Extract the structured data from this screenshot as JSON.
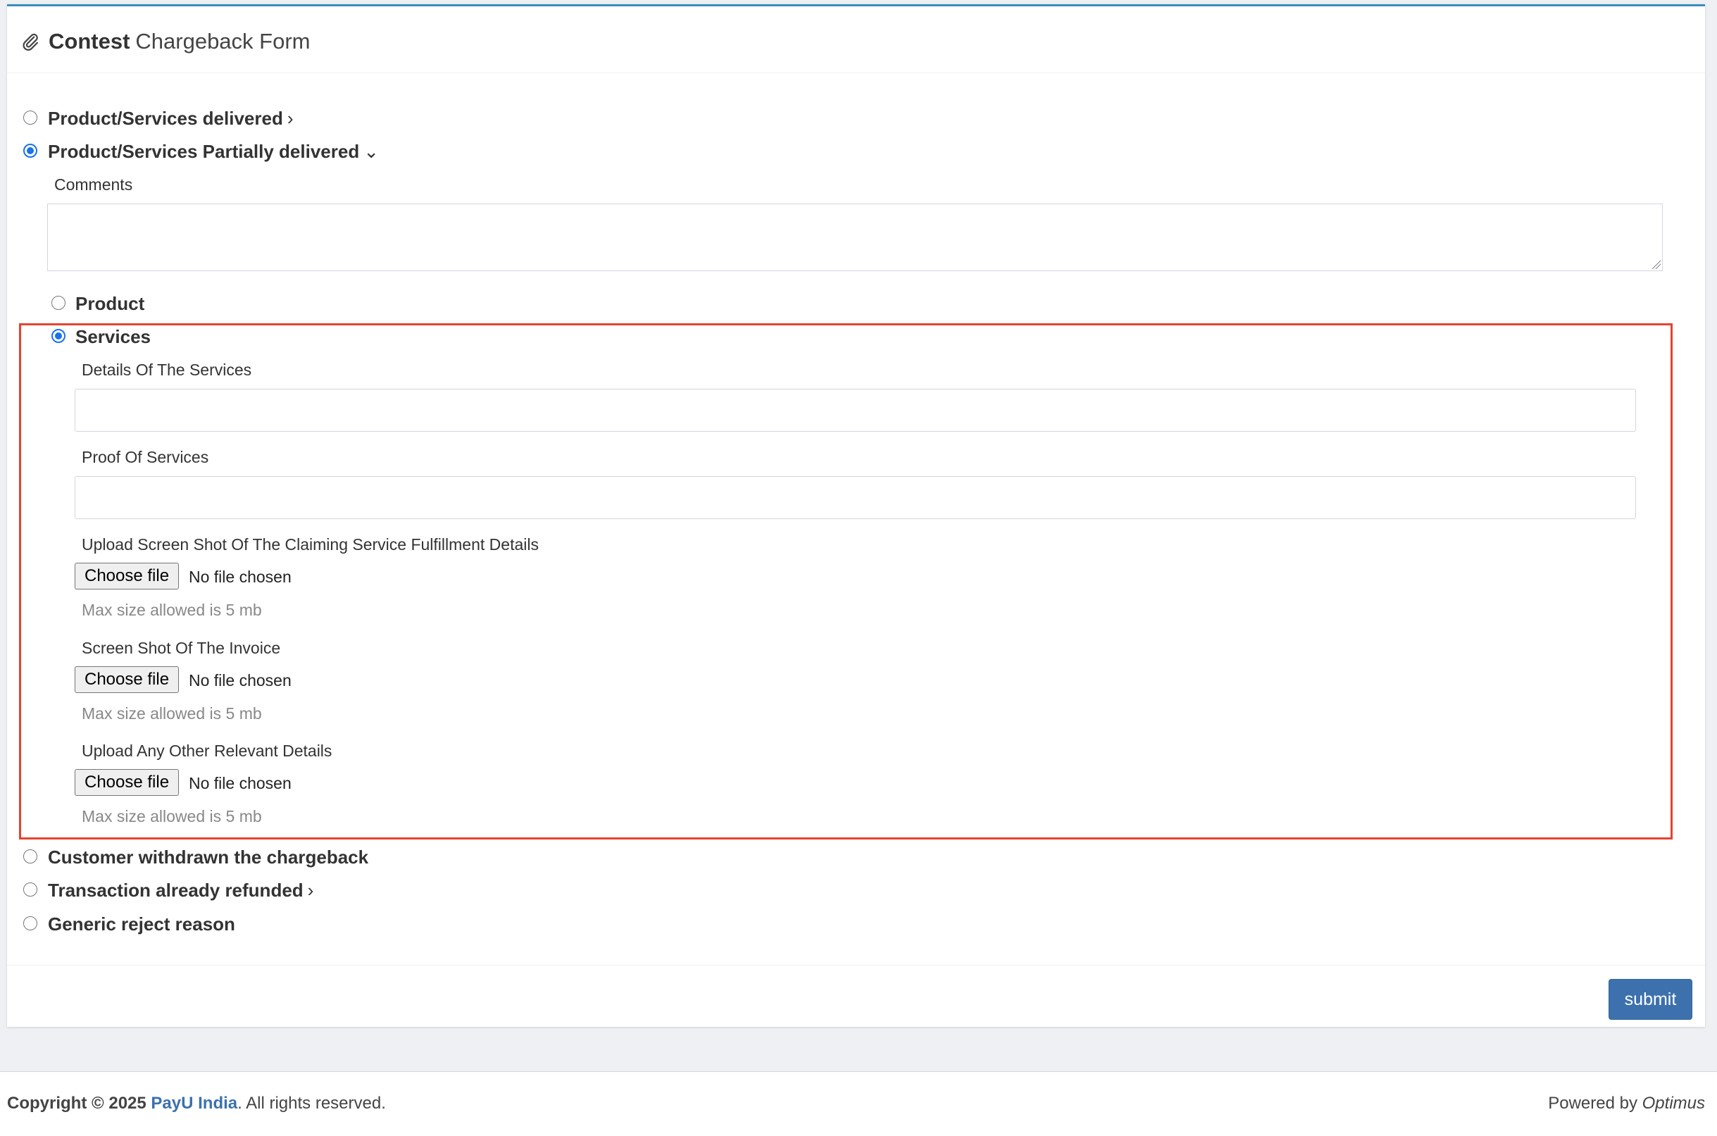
{
  "header": {
    "title_bold": "Contest",
    "title_rest": "Chargeback Form",
    "icon": "paperclip-icon"
  },
  "options": [
    {
      "label": "Product/Services delivered",
      "selected": false,
      "chevron": "›"
    },
    {
      "label": "Product/Services Partially delivered",
      "selected": true,
      "chevron": "⌄"
    },
    {
      "label": "Customer withdrawn the chargeback",
      "selected": false
    },
    {
      "label": "Transaction already refunded",
      "selected": false,
      "chevron": "›"
    },
    {
      "label": "Generic reject reason",
      "selected": false
    }
  ],
  "partial": {
    "comments_label": "Comments",
    "comments_value": "",
    "sub_options": [
      {
        "label": "Product",
        "selected": false
      },
      {
        "label": "Services",
        "selected": true
      }
    ]
  },
  "services": {
    "details_label": "Details Of The Services",
    "details_value": "",
    "proof_label": "Proof Of Services",
    "proof_value": "",
    "uploads": [
      {
        "label": "Upload Screen Shot Of The Claiming Service Fulfillment Details",
        "button": "Choose file",
        "status": "No file chosen",
        "help": "Max size allowed is 5 mb"
      },
      {
        "label": "Screen Shot Of The Invoice",
        "button": "Choose file",
        "status": "No file chosen",
        "help": "Max size allowed is 5 mb"
      },
      {
        "label": "Upload Any Other Relevant Details",
        "button": "Choose file",
        "status": "No file chosen",
        "help": "Max size allowed is 5 mb"
      }
    ]
  },
  "actions": {
    "submit_label": "submit"
  },
  "footer": {
    "copyright_prefix": "Copyright © 2025",
    "brand": "PayU India",
    "copyright_suffix": ". All rights reserved.",
    "powered_prefix": "Powered by",
    "powered_name": "Optimus"
  },
  "colors": {
    "accent": "#3c71ad",
    "radio_checked": "#1a73e8",
    "highlight": "#e5432f"
  }
}
